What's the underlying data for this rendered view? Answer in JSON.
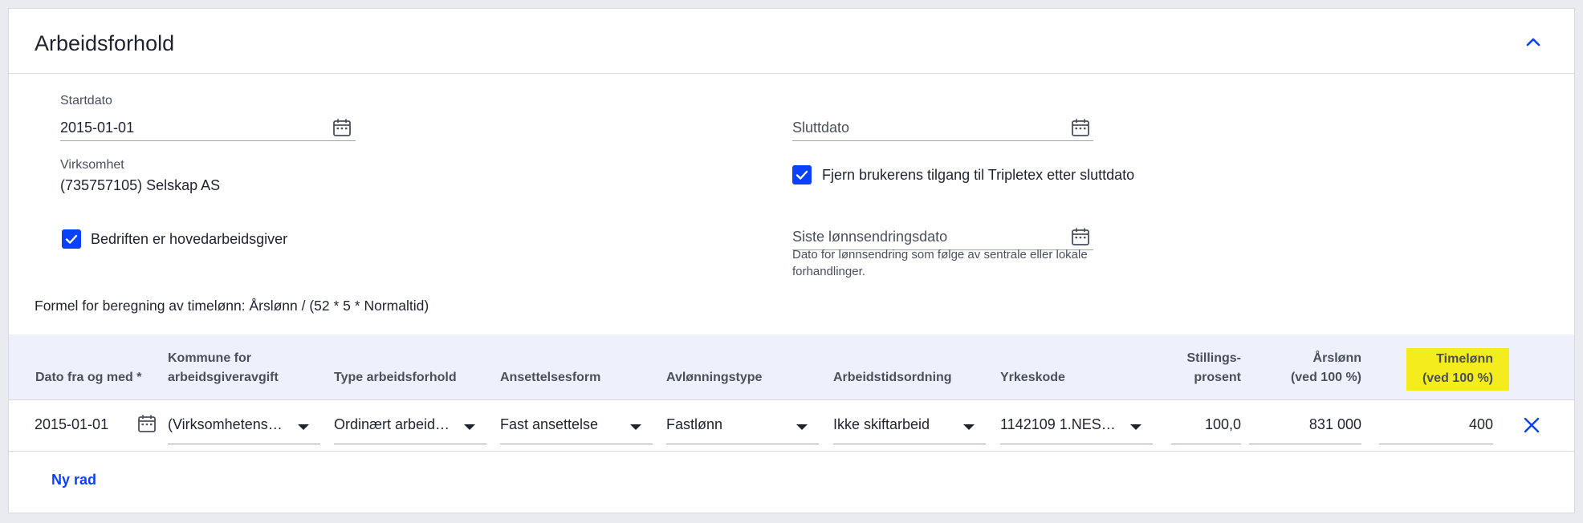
{
  "card": {
    "title": "Arbeidsforhold"
  },
  "form": {
    "startdato": {
      "label": "Startdato",
      "value": "2015-01-01"
    },
    "sluttdato": {
      "placeholder": "Sluttdato"
    },
    "virksomhet": {
      "label": "Virksomhet",
      "value": "(735757105) Selskap AS"
    },
    "remove_access": {
      "label": "Fjern brukerens tilgang til Tripletex etter sluttdato",
      "checked": true
    },
    "main_employer": {
      "label": "Bedriften er hovedarbeidsgiver",
      "checked": true
    },
    "siste_lonn": {
      "placeholder": "Siste lønnsendringsdato",
      "help": "Dato for lønnsendring som følge av sentrale eller lokale forhandlinger."
    },
    "formula": "Formel for beregning av timelønn: Årslønn / (52 * 5 * Normaltid)"
  },
  "table": {
    "headers": {
      "dato": "Dato fra og med *",
      "kommune_1": "Kommune for",
      "kommune_2": "arbeidsgiveravgift",
      "type": "Type arbeidsforhold",
      "ansettelse": "Ansettelsesform",
      "avlonning": "Avlønningstype",
      "arbeidstid": "Arbeidstidsordning",
      "yrkeskode": "Yrkeskode",
      "stilling_1": "Stillings-",
      "stilling_2": "prosent",
      "arslonn_1": "Årslønn",
      "arslonn_2": "(ved 100 %)",
      "timelonn_1": "Timelønn",
      "timelonn_2": "(ved 100 %)"
    },
    "rows": [
      {
        "dato": "2015-01-01",
        "kommune": "(Virksomhetens…",
        "type": "Ordinært arbeid…",
        "ansettelse": "Fast ansettelse",
        "avlonning": "Fastlønn",
        "arbeidstid": "Ikke skiftarbeid",
        "yrkeskode": "1142109 1.NES…",
        "stillingsprosent": "100,0",
        "arslonn": "831 000",
        "timelonn": "400"
      }
    ],
    "new_row_label": "Ny rad"
  },
  "colors": {
    "accent": "#0a41fa",
    "highlight": "#f4ec1c",
    "header_bg": "#eef1fb"
  }
}
